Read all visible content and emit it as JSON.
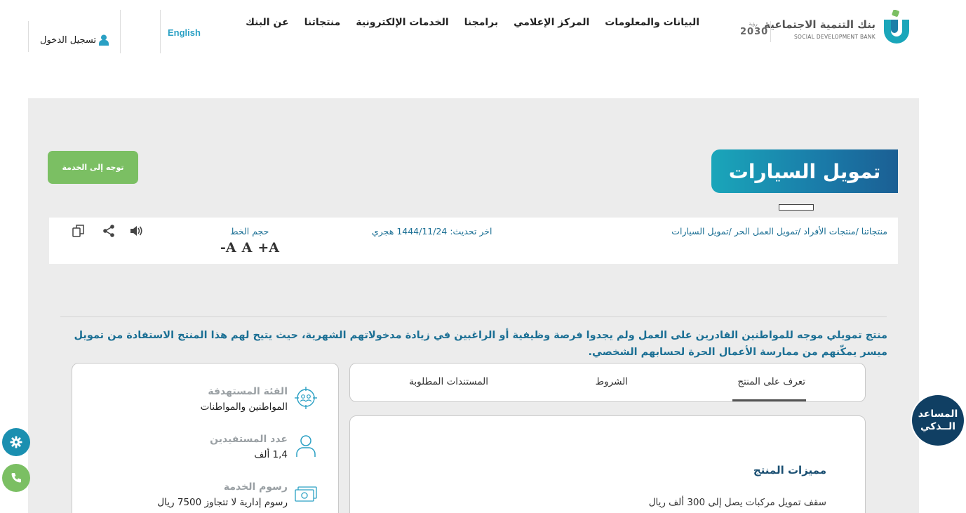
{
  "header": {
    "logo_ar": "بنك التنمية الاجتماعية",
    "logo_en": "SOCIAL DEVELOPMENT BANK",
    "vision_top": "رؤية",
    "vision_num": "2030",
    "nav": [
      "عن البنك",
      "منتجاتنا",
      "الخدمات الإلكترونية",
      "برامجنا",
      "المركز الإعلامي",
      "البيانات والمعلومات"
    ],
    "language": "English",
    "login": "تسجيل الدخول"
  },
  "product": {
    "service_button": "توجه إلى الخدمة",
    "title": "تمويل السيارات",
    "breadcrumb": "منتجاتنا /منتجات الأفراد /تمويل العمل الحر /تمويل السيارات",
    "last_updated": "اخر تحديث: 1444/11/24 هجري",
    "font_size_label": "حجم الخط",
    "font_controls": [
      "-A",
      "A",
      "+A"
    ],
    "description": "منتج تمويلي موجه للمواطنين القادرين على العمل ولم يجدوا فرصة وظيفية أو الراغبين في زيادة مدخولاتهم الشهرية، حيث يتيح لهم هذا المنتج الاستفادة من تمويل ميسر يمكّنهم من ممارسة الأعمال الحرة لحسابهم الشخصي."
  },
  "stats": [
    {
      "label": "الفئة المستهدفة",
      "value": "المواطنين والمواطنات",
      "icon": "target-group-icon"
    },
    {
      "label": "عدد المستفيدين",
      "value": "1,4 ألف",
      "icon": "person-icon"
    },
    {
      "label": "رسوم الخدمة",
      "value": "رسوم إدارية لا تتجاوز 7500 ريال",
      "icon": "money-icon"
    }
  ],
  "tabs": [
    "تعرف على المنتج",
    "الشروط",
    "المستندات المطلوبة"
  ],
  "features": {
    "title": "مميزات المنتج",
    "items": [
      "سقف تمويل مركبات يصل إلى 300 ألف ريال"
    ]
  },
  "assistant": {
    "line1": "المساعد",
    "line2": "الــذكي"
  },
  "colors": {
    "brand_teal": "#1a8fb0",
    "brand_green": "#7bbf63",
    "brand_navy": "#103f63",
    "text_blue": "#1b6f94"
  }
}
